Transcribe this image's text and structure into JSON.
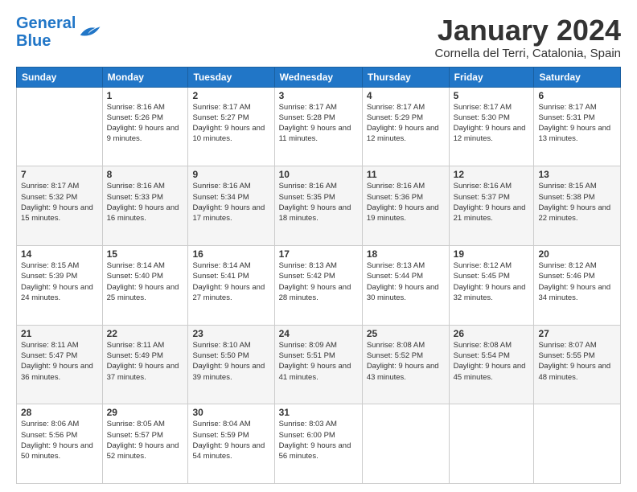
{
  "logo": {
    "text_general": "General",
    "text_blue": "Blue"
  },
  "header": {
    "month_title": "January 2024",
    "location": "Cornella del Terri, Catalonia, Spain"
  },
  "days_of_week": [
    "Sunday",
    "Monday",
    "Tuesday",
    "Wednesday",
    "Thursday",
    "Friday",
    "Saturday"
  ],
  "weeks": [
    [
      {
        "day": "",
        "sunrise": "",
        "sunset": "",
        "daylight": ""
      },
      {
        "day": "1",
        "sunrise": "Sunrise: 8:16 AM",
        "sunset": "Sunset: 5:26 PM",
        "daylight": "Daylight: 9 hours and 9 minutes."
      },
      {
        "day": "2",
        "sunrise": "Sunrise: 8:17 AM",
        "sunset": "Sunset: 5:27 PM",
        "daylight": "Daylight: 9 hours and 10 minutes."
      },
      {
        "day": "3",
        "sunrise": "Sunrise: 8:17 AM",
        "sunset": "Sunset: 5:28 PM",
        "daylight": "Daylight: 9 hours and 11 minutes."
      },
      {
        "day": "4",
        "sunrise": "Sunrise: 8:17 AM",
        "sunset": "Sunset: 5:29 PM",
        "daylight": "Daylight: 9 hours and 12 minutes."
      },
      {
        "day": "5",
        "sunrise": "Sunrise: 8:17 AM",
        "sunset": "Sunset: 5:30 PM",
        "daylight": "Daylight: 9 hours and 12 minutes."
      },
      {
        "day": "6",
        "sunrise": "Sunrise: 8:17 AM",
        "sunset": "Sunset: 5:31 PM",
        "daylight": "Daylight: 9 hours and 13 minutes."
      }
    ],
    [
      {
        "day": "7",
        "sunrise": "Sunrise: 8:17 AM",
        "sunset": "Sunset: 5:32 PM",
        "daylight": "Daylight: 9 hours and 15 minutes."
      },
      {
        "day": "8",
        "sunrise": "Sunrise: 8:16 AM",
        "sunset": "Sunset: 5:33 PM",
        "daylight": "Daylight: 9 hours and 16 minutes."
      },
      {
        "day": "9",
        "sunrise": "Sunrise: 8:16 AM",
        "sunset": "Sunset: 5:34 PM",
        "daylight": "Daylight: 9 hours and 17 minutes."
      },
      {
        "day": "10",
        "sunrise": "Sunrise: 8:16 AM",
        "sunset": "Sunset: 5:35 PM",
        "daylight": "Daylight: 9 hours and 18 minutes."
      },
      {
        "day": "11",
        "sunrise": "Sunrise: 8:16 AM",
        "sunset": "Sunset: 5:36 PM",
        "daylight": "Daylight: 9 hours and 19 minutes."
      },
      {
        "day": "12",
        "sunrise": "Sunrise: 8:16 AM",
        "sunset": "Sunset: 5:37 PM",
        "daylight": "Daylight: 9 hours and 21 minutes."
      },
      {
        "day": "13",
        "sunrise": "Sunrise: 8:15 AM",
        "sunset": "Sunset: 5:38 PM",
        "daylight": "Daylight: 9 hours and 22 minutes."
      }
    ],
    [
      {
        "day": "14",
        "sunrise": "Sunrise: 8:15 AM",
        "sunset": "Sunset: 5:39 PM",
        "daylight": "Daylight: 9 hours and 24 minutes."
      },
      {
        "day": "15",
        "sunrise": "Sunrise: 8:14 AM",
        "sunset": "Sunset: 5:40 PM",
        "daylight": "Daylight: 9 hours and 25 minutes."
      },
      {
        "day": "16",
        "sunrise": "Sunrise: 8:14 AM",
        "sunset": "Sunset: 5:41 PM",
        "daylight": "Daylight: 9 hours and 27 minutes."
      },
      {
        "day": "17",
        "sunrise": "Sunrise: 8:13 AM",
        "sunset": "Sunset: 5:42 PM",
        "daylight": "Daylight: 9 hours and 28 minutes."
      },
      {
        "day": "18",
        "sunrise": "Sunrise: 8:13 AM",
        "sunset": "Sunset: 5:44 PM",
        "daylight": "Daylight: 9 hours and 30 minutes."
      },
      {
        "day": "19",
        "sunrise": "Sunrise: 8:12 AM",
        "sunset": "Sunset: 5:45 PM",
        "daylight": "Daylight: 9 hours and 32 minutes."
      },
      {
        "day": "20",
        "sunrise": "Sunrise: 8:12 AM",
        "sunset": "Sunset: 5:46 PM",
        "daylight": "Daylight: 9 hours and 34 minutes."
      }
    ],
    [
      {
        "day": "21",
        "sunrise": "Sunrise: 8:11 AM",
        "sunset": "Sunset: 5:47 PM",
        "daylight": "Daylight: 9 hours and 36 minutes."
      },
      {
        "day": "22",
        "sunrise": "Sunrise: 8:11 AM",
        "sunset": "Sunset: 5:49 PM",
        "daylight": "Daylight: 9 hours and 37 minutes."
      },
      {
        "day": "23",
        "sunrise": "Sunrise: 8:10 AM",
        "sunset": "Sunset: 5:50 PM",
        "daylight": "Daylight: 9 hours and 39 minutes."
      },
      {
        "day": "24",
        "sunrise": "Sunrise: 8:09 AM",
        "sunset": "Sunset: 5:51 PM",
        "daylight": "Daylight: 9 hours and 41 minutes."
      },
      {
        "day": "25",
        "sunrise": "Sunrise: 8:08 AM",
        "sunset": "Sunset: 5:52 PM",
        "daylight": "Daylight: 9 hours and 43 minutes."
      },
      {
        "day": "26",
        "sunrise": "Sunrise: 8:08 AM",
        "sunset": "Sunset: 5:54 PM",
        "daylight": "Daylight: 9 hours and 45 minutes."
      },
      {
        "day": "27",
        "sunrise": "Sunrise: 8:07 AM",
        "sunset": "Sunset: 5:55 PM",
        "daylight": "Daylight: 9 hours and 48 minutes."
      }
    ],
    [
      {
        "day": "28",
        "sunrise": "Sunrise: 8:06 AM",
        "sunset": "Sunset: 5:56 PM",
        "daylight": "Daylight: 9 hours and 50 minutes."
      },
      {
        "day": "29",
        "sunrise": "Sunrise: 8:05 AM",
        "sunset": "Sunset: 5:57 PM",
        "daylight": "Daylight: 9 hours and 52 minutes."
      },
      {
        "day": "30",
        "sunrise": "Sunrise: 8:04 AM",
        "sunset": "Sunset: 5:59 PM",
        "daylight": "Daylight: 9 hours and 54 minutes."
      },
      {
        "day": "31",
        "sunrise": "Sunrise: 8:03 AM",
        "sunset": "Sunset: 6:00 PM",
        "daylight": "Daylight: 9 hours and 56 minutes."
      },
      {
        "day": "",
        "sunrise": "",
        "sunset": "",
        "daylight": ""
      },
      {
        "day": "",
        "sunrise": "",
        "sunset": "",
        "daylight": ""
      },
      {
        "day": "",
        "sunrise": "",
        "sunset": "",
        "daylight": ""
      }
    ]
  ]
}
